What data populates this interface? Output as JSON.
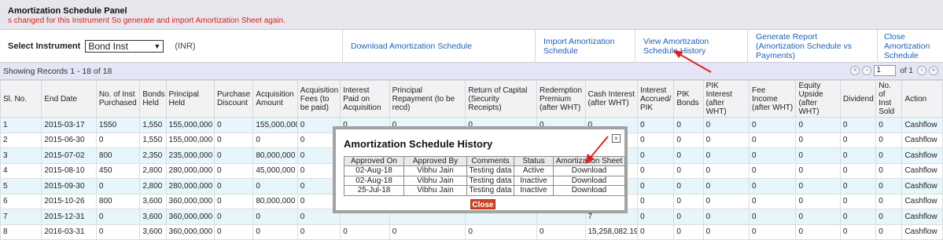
{
  "panel": {
    "title": "Amortization Schedule Panel",
    "warning": "s changed for this Instrument So generate and import Amortization Sheet again."
  },
  "toolbar": {
    "select_label": "Select Instrument",
    "instrument_value": "Bond Inst",
    "currency": "(INR)",
    "download_link": "Download Amortization Schedule",
    "import_link": "Import Amortization Schedule",
    "view_history_link": "View Amortization Schedule History",
    "generate_report_link": "Generate Report (Amortization Schedule vs Payments)",
    "close_link": "Close Amortization Schedule"
  },
  "records": {
    "showing": "Showing Records 1 - 18 of 18",
    "page_value": "1",
    "of_pages": "of 1"
  },
  "table": {
    "headers": [
      "Sl. No.",
      "End Date",
      "No. of Inst Purchased",
      "Bonds Held",
      "Principal Held",
      "Purchase Discount",
      "Acquisition Amount",
      "Acquisition Fees (to be paid)",
      "Interest Paid on Acquisition",
      "Principal Repayment (to be recd)",
      "Return of Capital (Security Receipts)",
      "Redemption Premium (after WHT)",
      "Cash Interest (after WHT)",
      "Interest Accrued/ PIK",
      "PIK Bonds",
      "PIK Interest (after WHT)",
      "Fee Income (after WHT)",
      "Equity Upside (after WHT)",
      "Dividend",
      "No. of Inst Sold",
      "Action"
    ],
    "rows": [
      [
        "1",
        "2015-03-17",
        "1550",
        "1,550",
        "155,000,000",
        "0",
        "155,000,000",
        "0",
        "0",
        "0",
        "0",
        "0",
        "0",
        "0",
        "0",
        "0",
        "0",
        "0",
        "0",
        "0",
        "Cashflow"
      ],
      [
        "2",
        "2015-06-30",
        "0",
        "1,550",
        "155,000,000",
        "0",
        "0",
        "0",
        "",
        "",
        "",
        "",
        "",
        "0",
        "0",
        "0",
        "0",
        "0",
        "0",
        "0",
        "Cashflow"
      ],
      [
        "3",
        "2015-07-02",
        "800",
        "2,350",
        "235,000,000",
        "0",
        "80,000,000",
        "0",
        "",
        "",
        "",
        "",
        "",
        "0",
        "0",
        "0",
        "0",
        "0",
        "0",
        "0",
        "Cashflow"
      ],
      [
        "4",
        "2015-08-10",
        "450",
        "2,800",
        "280,000,000",
        "0",
        "45,000,000",
        "0",
        "",
        "",
        "",
        "",
        "4",
        "0",
        "0",
        "0",
        "0",
        "0",
        "0",
        "0",
        "Cashflow"
      ],
      [
        "5",
        "2015-09-30",
        "0",
        "2,800",
        "280,000,000",
        "0",
        "0",
        "0",
        "",
        "",
        "",
        "",
        "6",
        "0",
        "0",
        "0",
        "0",
        "0",
        "0",
        "0",
        "Cashflow"
      ],
      [
        "6",
        "2015-10-26",
        "800",
        "3,600",
        "360,000,000",
        "0",
        "80,000,000",
        "0",
        "",
        "",
        "",
        "",
        "",
        "0",
        "0",
        "0",
        "0",
        "0",
        "0",
        "0",
        "Cashflow"
      ],
      [
        "7",
        "2015-12-31",
        "0",
        "3,600",
        "360,000,000",
        "0",
        "0",
        "0",
        "",
        "",
        "",
        "",
        "7",
        "0",
        "0",
        "0",
        "0",
        "0",
        "0",
        "0",
        "Cashflow"
      ],
      [
        "8",
        "2016-03-31",
        "0",
        "3,600",
        "360,000,000",
        "0",
        "0",
        "0",
        "0",
        "0",
        "0",
        "0",
        "15,258,082.19",
        "0",
        "0",
        "0",
        "0",
        "0",
        "0",
        "0",
        "Cashflow"
      ]
    ]
  },
  "modal": {
    "title": "Amortization Schedule History",
    "close_icon": "close-x",
    "headers": [
      "Approved On",
      "Approved By",
      "Comments",
      "Status",
      "Amortization Sheet"
    ],
    "rows": [
      [
        "02-Aug-18",
        "Vibhu Jain",
        "Testing data",
        "Active",
        "Download"
      ],
      [
        "02-Aug-18",
        "Vibhu Jain",
        "Testing data",
        "Inactive",
        "Download"
      ],
      [
        "25-Jul-18",
        "Vibhu Jain",
        "Testing data",
        "Inactive",
        "Download"
      ]
    ],
    "close_button": "Close"
  },
  "colors": {
    "link": "#1f5fb8",
    "warning": "#e02020",
    "close_button": "#d2431f",
    "annotation_arrow": "#e02020",
    "odd_row": "#e6f6fb"
  }
}
